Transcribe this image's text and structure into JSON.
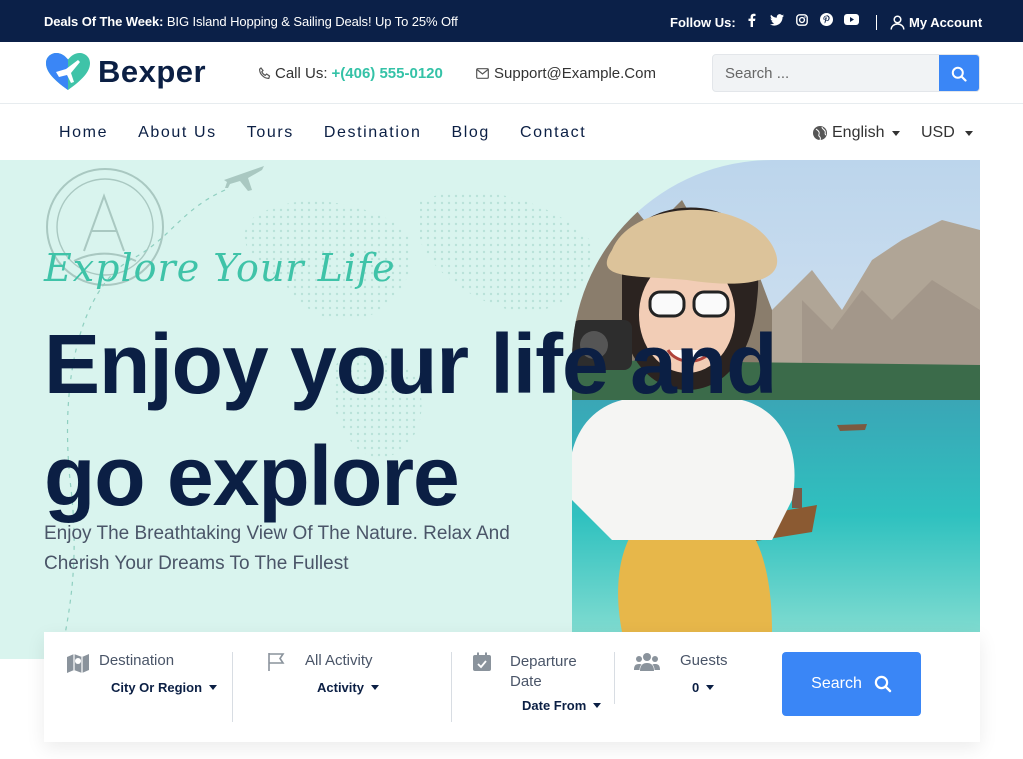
{
  "topbar": {
    "deals_prefix": "Deals Of The Week:",
    "deals_text": "BIG Island Hopping & Sailing Deals! Up To 25% Off",
    "follow_label": "Follow Us:",
    "social_icons": [
      "facebook-icon",
      "twitter-icon",
      "instagram-icon",
      "pinterest-icon",
      "youtube-icon"
    ],
    "account_label": "My Account"
  },
  "header": {
    "logo_text": "Bexper",
    "call_label": "Call Us:",
    "phone": "+(406) 555-0120",
    "email": "Support@Example.Com",
    "search_placeholder": "Search ..."
  },
  "nav": {
    "items": [
      "Home",
      "About Us",
      "Tours",
      "Destination",
      "Blog",
      "Contact"
    ],
    "language": "English",
    "currency": "USD"
  },
  "hero": {
    "script": "Explore Your Life",
    "headline": "Enjoy your life and go explore",
    "subtitle": "Enjoy The Breathtaking View Of The Nature. Relax And Cherish Your Dreams To The Fullest"
  },
  "search_panel": {
    "destination_label": "Destination",
    "destination_value": "City Or Region",
    "activity_label": "All Activity",
    "activity_value": "Activity",
    "date_label": "Departure Date",
    "date_value": "Date From",
    "guests_label": "Guests",
    "guests_value": "0",
    "search_button": "Search"
  },
  "colors": {
    "navy": "#0b2048",
    "accent_green": "#3fc3a8",
    "button_blue": "#3a86f6",
    "hero_bg": "#d9f4ee"
  }
}
